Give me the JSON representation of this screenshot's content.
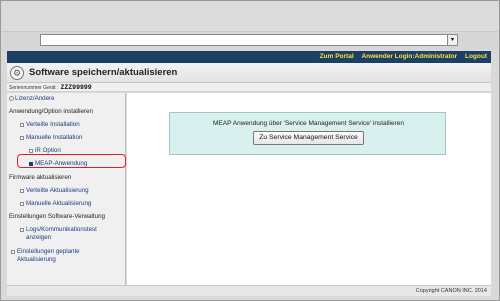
{
  "browser": {
    "address_value": "",
    "dropdown_arrow": "▾"
  },
  "portal_bar": {
    "portal_link": "Zum Portal",
    "login_info": "Anwender Login:Administrator",
    "logout_link": "Logout"
  },
  "header": {
    "title": "Software speichern/aktualisieren",
    "serial_label": "Seriennummer Gerät :",
    "serial_value": "ZZZ99999"
  },
  "sidebar": {
    "items": [
      {
        "label": "Lizenz/Andere"
      },
      {
        "label": "Anwendung/Option installieren"
      },
      {
        "label": "Verteilte Installation"
      },
      {
        "label": "Manuelle Installation"
      },
      {
        "label": "iR Option"
      },
      {
        "label": "MEAP-Anwendung"
      },
      {
        "label": "Firmware aktualisieren"
      },
      {
        "label": "Verteilte Aktualisierung"
      },
      {
        "label": "Manuelle Aktualisierung"
      },
      {
        "label": "Einstellungen Software-Verwaltung"
      },
      {
        "label": "Logs/Kommunikationstest"
      },
      {
        "label": "anzeigen"
      },
      {
        "label": "Einstellungen geplante"
      },
      {
        "label": "Aktualisierung"
      }
    ]
  },
  "main": {
    "meap_message": "MEAP Anwendung über 'Service Management Service' installieren",
    "meap_button": "Zu Service Management Service"
  },
  "footer": {
    "copyright": "Copyright CANON INC. 2014"
  }
}
